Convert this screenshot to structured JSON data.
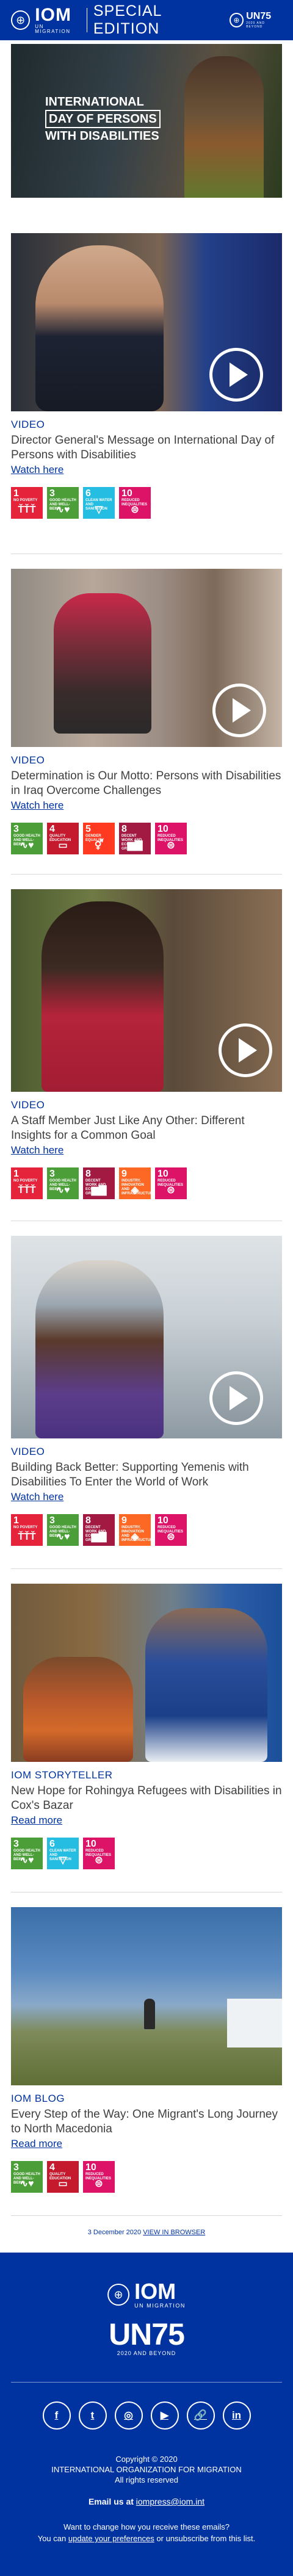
{
  "header": {
    "logo_text": "IOM",
    "logo_sub": "UN MIGRATION",
    "edition": "SPECIAL EDITION",
    "un75_text": "UN75",
    "un75_sub": "2020 AND BEYOND"
  },
  "hero": {
    "line1": "INTERNATIONAL",
    "line2": "DAY OF PERSONS",
    "line3": "WITH DISABILITIES"
  },
  "articles": [
    {
      "kicker": "VIDEO",
      "title": "Director General's Message on International Day of Persons with Disabilities",
      "link": "Watch here",
      "sdgs": [
        {
          "num": "1",
          "label": "NO POVERTY",
          "color": "#e5243b",
          "icon": "family-icon"
        },
        {
          "num": "3",
          "label": "GOOD HEALTH AND WELL-BEING",
          "color": "#4c9f38",
          "icon": "heartbeat-icon"
        },
        {
          "num": "6",
          "label": "CLEAN WATER AND SANITATION",
          "color": "#26bde2",
          "icon": "water-icon"
        },
        {
          "num": "10",
          "label": "REDUCED INEQUALITIES",
          "color": "#dd1367",
          "icon": "equality-icon"
        }
      ]
    },
    {
      "kicker": "VIDEO",
      "title": "Determination is Our Motto: Persons with Disabilities in Iraq Overcome Challenges",
      "link": "Watch here",
      "sdgs": [
        {
          "num": "3",
          "label": "GOOD HEALTH AND WELL-BEING",
          "color": "#4c9f38",
          "icon": "heartbeat-icon"
        },
        {
          "num": "4",
          "label": "QUALITY EDUCATION",
          "color": "#c5192d",
          "icon": "book-icon"
        },
        {
          "num": "5",
          "label": "GENDER EQUALITY",
          "color": "#ff3a21",
          "icon": "gender-icon"
        },
        {
          "num": "8",
          "label": "DECENT WORK AND ECONOMIC GROWTH",
          "color": "#a21942",
          "icon": "growth-icon"
        },
        {
          "num": "10",
          "label": "REDUCED INEQUALITIES",
          "color": "#dd1367",
          "icon": "equality-icon"
        }
      ]
    },
    {
      "kicker": "VIDEO",
      "title": "A Staff Member Just Like Any Other: Different Insights for a Common Goal",
      "link": "Watch here",
      "sdgs": [
        {
          "num": "1",
          "label": "NO POVERTY",
          "color": "#e5243b",
          "icon": "family-icon"
        },
        {
          "num": "3",
          "label": "GOOD HEALTH AND WELL-BEING",
          "color": "#4c9f38",
          "icon": "heartbeat-icon"
        },
        {
          "num": "8",
          "label": "DECENT WORK AND ECONOMIC GROWTH",
          "color": "#a21942",
          "icon": "growth-icon"
        },
        {
          "num": "9",
          "label": "INDUSTRY, INNOVATION AND INFRASTRUCTURE",
          "color": "#fd6925",
          "icon": "cubes-icon"
        },
        {
          "num": "10",
          "label": "REDUCED INEQUALITIES",
          "color": "#dd1367",
          "icon": "equality-icon"
        }
      ]
    },
    {
      "kicker": "VIDEO",
      "title": "Building Back Better: Supporting Yemenis with Disabilities To Enter the World of Work",
      "link": "Watch here",
      "sdgs": [
        {
          "num": "1",
          "label": "NO POVERTY",
          "color": "#e5243b",
          "icon": "family-icon"
        },
        {
          "num": "3",
          "label": "GOOD HEALTH AND WELL-BEING",
          "color": "#4c9f38",
          "icon": "heartbeat-icon"
        },
        {
          "num": "8",
          "label": "DECENT WORK AND ECONOMIC GROWTH",
          "color": "#a21942",
          "icon": "growth-icon"
        },
        {
          "num": "9",
          "label": "INDUSTRY, INNOVATION AND INFRASTRUCTURE",
          "color": "#fd6925",
          "icon": "cubes-icon"
        },
        {
          "num": "10",
          "label": "REDUCED INEQUALITIES",
          "color": "#dd1367",
          "icon": "equality-icon"
        }
      ]
    },
    {
      "kicker": "IOM STORYTELLER",
      "title": "New Hope for Rohingya Refugees with Disabilities in Cox's Bazar",
      "link": "Read more",
      "sdgs": [
        {
          "num": "3",
          "label": "GOOD HEALTH AND WELL-BEING",
          "color": "#4c9f38",
          "icon": "heartbeat-icon"
        },
        {
          "num": "6",
          "label": "CLEAN WATER AND SANITATION",
          "color": "#26bde2",
          "icon": "water-icon"
        },
        {
          "num": "10",
          "label": "REDUCED INEQUALITIES",
          "color": "#dd1367",
          "icon": "equality-icon"
        }
      ]
    },
    {
      "kicker": "IOM BLOG",
      "title": "Every Step of the Way: One Migrant's Long Journey to North Macedonia",
      "link": "Read more",
      "sdgs": [
        {
          "num": "3",
          "label": "GOOD HEALTH AND WELL-BEING",
          "color": "#4c9f38",
          "icon": "heartbeat-icon"
        },
        {
          "num": "4",
          "label": "QUALITY EDUCATION",
          "color": "#c5192d",
          "icon": "book-icon"
        },
        {
          "num": "10",
          "label": "REDUCED INEQUALITIES",
          "color": "#dd1367",
          "icon": "equality-icon"
        }
      ]
    }
  ],
  "date_line": {
    "date": "3 December 2020",
    "link": "VIEW IN BROWSER"
  },
  "footer": {
    "logo_text": "IOM",
    "logo_sub": "UN MIGRATION",
    "un75_text": "UN75",
    "un75_sub": "2020 AND BEYOND",
    "socials": [
      {
        "name": "facebook-icon",
        "glyph": "f"
      },
      {
        "name": "twitter-icon",
        "glyph": "t"
      },
      {
        "name": "instagram-icon",
        "glyph": "◎"
      },
      {
        "name": "youtube-icon",
        "glyph": "▶"
      },
      {
        "name": "link-icon",
        "glyph": "🔗"
      },
      {
        "name": "linkedin-icon",
        "glyph": "in"
      }
    ],
    "copyright": "Copyright © 2020",
    "org": "INTERNATIONAL ORGANIZATION FOR MIGRATION",
    "rights": "All rights reserved",
    "email_label": "Email us at",
    "email": "iompress@iom.int",
    "change_q": "Want to change how you receive these emails?",
    "change_pre": "You can",
    "change_link": "update your preferences",
    "change_post": "or unsubscribe from this list."
  }
}
